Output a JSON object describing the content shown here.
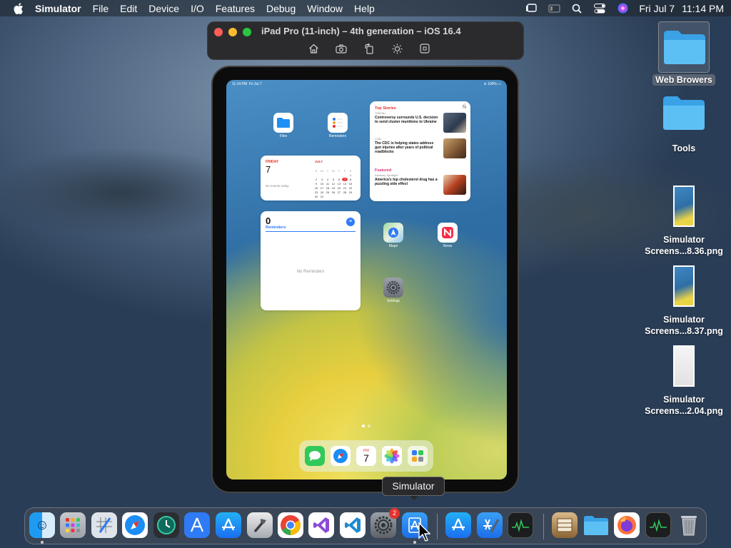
{
  "menubar": {
    "app_name": "Simulator",
    "items": [
      "File",
      "Edit",
      "Device",
      "I/O",
      "Features",
      "Debug",
      "Window",
      "Help"
    ],
    "date": "Fri Jul 7",
    "time": "11:14 PM"
  },
  "simulator_window": {
    "title": "iPad Pro (11-inch) – 4th generation – iOS 16.4",
    "toolbar_icons": [
      "home-icon",
      "screenshot-icon",
      "rotate-icon",
      "appearance-icon",
      "command-icon"
    ]
  },
  "ipad": {
    "status_time": "11:14 PM",
    "status_date": "Fri Jul 7",
    "status_battery": "100%",
    "apps": {
      "files": "Files",
      "reminders": "Reminders",
      "maps": "Maps",
      "news": "News",
      "settings": "Settings"
    },
    "calendar_widget": {
      "day_name": "FRIDAY",
      "day_number": "7",
      "no_events": "No events today",
      "month": "JULY",
      "weekdays": [
        "S",
        "M",
        "T",
        "W",
        "T",
        "F",
        "S"
      ],
      "days": [
        "",
        "",
        "",
        "",
        "",
        "",
        "1",
        "2",
        "3",
        "4",
        "5",
        "6",
        "7",
        "8",
        "9",
        "10",
        "11",
        "12",
        "13",
        "14",
        "15",
        "16",
        "17",
        "18",
        "19",
        "20",
        "21",
        "22",
        "23",
        "24",
        "25",
        "26",
        "27",
        "28",
        "29",
        "30",
        "31"
      ],
      "today_index": 12
    },
    "reminders_widget": {
      "count": "0",
      "title": "Reminders",
      "empty_text": "No Reminders"
    },
    "news_widget": {
      "section1": "Top Stories",
      "story1_source": "THEHILL",
      "story1": "Controversy surrounds U.S. decision to send cluster munitions to Ukraine",
      "story2_source": "CNN",
      "story2": "The CDC is helping states address gun injuries after years of political roadblocks",
      "section2": "Featured",
      "story3_source": "Advisory Spotlight",
      "story3": "America's top cholesterol drug has a puzzling side effect"
    },
    "dock_calendar": {
      "day_name": "FRI",
      "day_number": "7"
    }
  },
  "desktop_icons": [
    {
      "label": "Web Browers",
      "selected": true
    },
    {
      "label": "Tools",
      "selected": false
    },
    {
      "label": "Simulator\nScreens...8.36.png"
    },
    {
      "label": "Simulator\nScreens...8.37.png"
    },
    {
      "label": "Simulator\nScreens...2.04.png"
    }
  ],
  "tooltip": "Simulator",
  "dock": {
    "apps": [
      "Finder",
      "Launchpad",
      "Sketch",
      "Safari",
      "Time Machine",
      "Instruments",
      "App Store",
      "Xcode Helper",
      "Chrome",
      "Visual Studio",
      "VS Code",
      "System Settings",
      "Simulator",
      "App Store",
      "Xcode",
      "Activity Monitor",
      "Archive",
      "Folder",
      "Firefox",
      "Activity Monitor",
      "Trash"
    ],
    "settings_badge": "2"
  },
  "colors": {
    "accent_blue": "#2f7bf5",
    "red": "#ff5f57",
    "yellow": "#febc2e",
    "green": "#28c840"
  }
}
